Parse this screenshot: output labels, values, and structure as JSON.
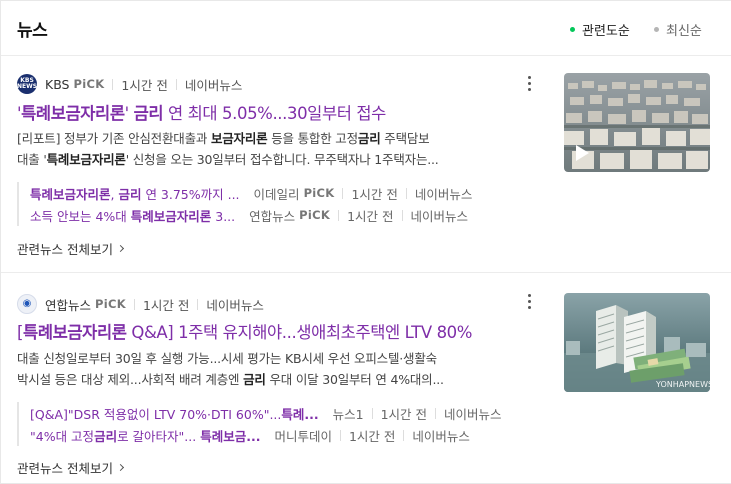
{
  "header": {
    "title": "뉴스",
    "sort_options": [
      {
        "label": "관련도순",
        "active": true,
        "color": "#03c75a"
      },
      {
        "label": "최신순",
        "active": false,
        "color": "#b5b5b5"
      }
    ]
  },
  "news": [
    {
      "press": {
        "name": "KBS",
        "pick": "PiCK",
        "logo_text": "KBS NEWS",
        "logo_color": "#1a2f6e"
      },
      "time": "1시간 전",
      "portal": "네이버뉴스",
      "title_pre": "'",
      "title_bold": "특례보금자리론",
      "title_mid": "' ",
      "title_bold2": "금리",
      "title_post": " 연 최대 5.05%...30일부터 접수",
      "desc": [
        [
          "[리포트] 정부가 기존 안심전환대출과 ",
          "보금자리론",
          " 등을 통합한 고정",
          "금리",
          " 주택담보"
        ],
        [
          "대출 '",
          "특례보금자리론",
          "' 신청을 오는 30일부터 접수합니다. 무주택자나 1주택자는...",
          "",
          ""
        ]
      ],
      "related": [
        {
          "t_bold": "특례보금자리론",
          "t_mid": ", ",
          "t_bold2": "금리",
          "t_post": " 연 3.75%까지 ...",
          "press": "이데일리",
          "pick": "PiCK",
          "time": "1시간 전",
          "portal": "네이버뉴스"
        },
        {
          "t_pre": "소득 안보는 4%대 ",
          "t_bold": "특례보금자리론",
          "t_post": " 3...",
          "press": "연합뉴스",
          "pick": "PiCK",
          "time": "1시간 전",
          "portal": "네이버뉴스"
        }
      ],
      "more_label": "관련뉴스 전체보기"
    },
    {
      "press": {
        "name": "연합뉴스",
        "pick": "PiCK",
        "logo_text": "◉",
        "logo_color": "#1f56b8"
      },
      "time": "1시간 전",
      "portal": "네이버뉴스",
      "title_pre": "[",
      "title_bold": "특례보금자리론",
      "title_post": " Q&A] 1주택 유지해야...생애최초주택엔 LTV 80%",
      "desc": [
        [
          "대출 신청일로부터 30일 후 실행 가능...시세 평가는 KB시세 우선 오피스텔·생활숙",
          "",
          "",
          "",
          ""
        ],
        [
          "박시설 등은 대상 제외...사회적 배려 계층엔 ",
          "금리",
          " 우대 이달 30일부터 연 4%대의...",
          "",
          ""
        ]
      ],
      "related": [
        {
          "t_pre": "[Q&A]\"DSR 적용없이 LTV 70%·DTI 60%\"...",
          "t_bold": "특례...",
          "press": "뉴스1",
          "time": "1시간 전",
          "portal": "네이버뉴스"
        },
        {
          "t_pre": "\"4%대 고정",
          "t_bold": "금리",
          "t_mid": "로 갈아타자\"... ",
          "t_bold2": "특례보금...",
          "press": "머니투데이",
          "time": "1시간 전",
          "portal": "네이버뉴스"
        }
      ],
      "more_label": "관련뉴스 전체보기",
      "thumb_watermark": "YONHAPNEWS"
    }
  ]
}
